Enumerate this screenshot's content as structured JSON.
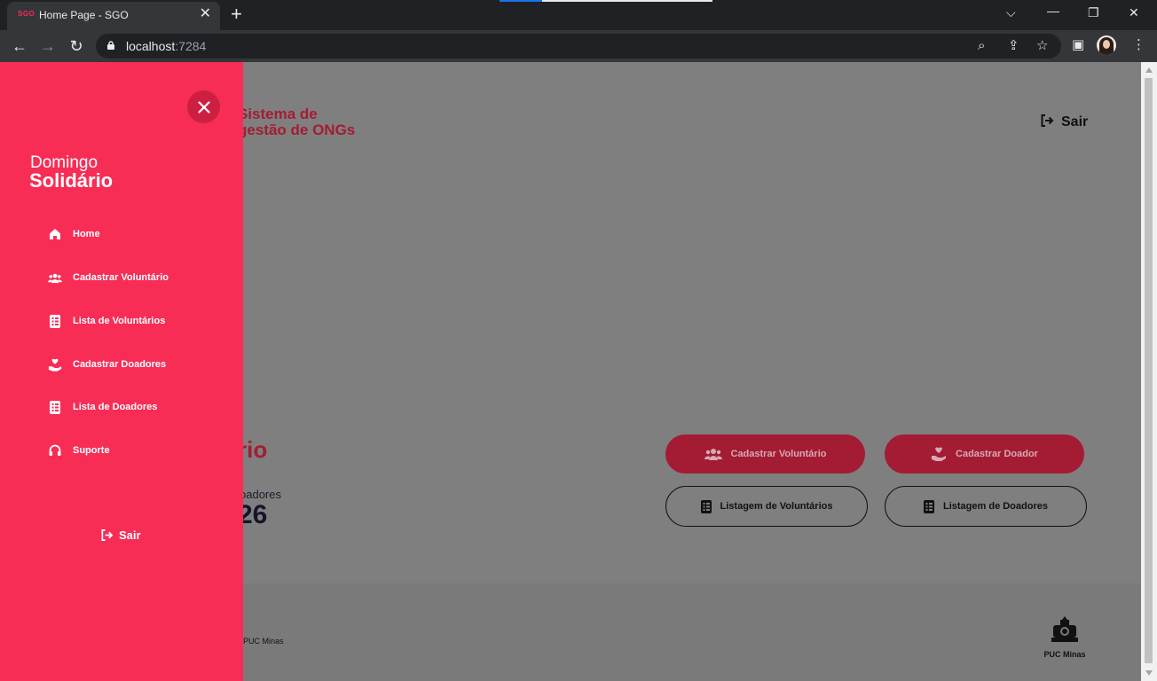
{
  "browser": {
    "tab_favicon": "SGO",
    "tab_title": "Home Page - SGO",
    "url_host": "localhost",
    "url_port": ":7284"
  },
  "page": {
    "brand_line1": "Sistema de",
    "brand_line2": "gestão de ONGs",
    "header_logout": "Sair",
    "section_title_partial": "rio",
    "stat_label_partial": "oadores",
    "stat_value_partial": "26",
    "buttons": {
      "register_volunteer": "Cadastrar Voluntário",
      "register_donor": "Cadastrar Doador",
      "list_volunteers": "Listagem de Voluntários",
      "list_donors": "Listagem de Doadores"
    },
    "footer_text": "PUC Minas",
    "footer_logo_text": "PUC Minas"
  },
  "drawer": {
    "logo_line1": "Domingo",
    "logo_line2": "Solidário",
    "items": [
      {
        "label": "Home",
        "icon": "home-icon"
      },
      {
        "label": "Cadastrar Voluntário",
        "icon": "users-icon"
      },
      {
        "label": "Lista de Voluntários",
        "icon": "list-icon"
      },
      {
        "label": "Cadastrar Doadores",
        "icon": "hand-heart-icon"
      },
      {
        "label": "Lista de Doadores",
        "icon": "list-icon"
      },
      {
        "label": "Suporte",
        "icon": "headset-icon"
      }
    ],
    "logout": "Sair"
  },
  "colors": {
    "drawer_bg": "#f72d56",
    "accent_dark": "#a31c34",
    "overlay_bg": "#7f7f7f"
  }
}
